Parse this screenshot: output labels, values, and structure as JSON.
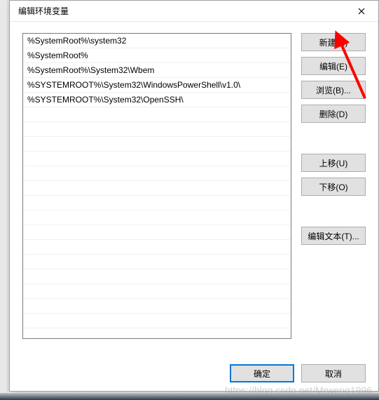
{
  "dialog": {
    "title": "编辑环境变量",
    "close_icon": "close"
  },
  "list": {
    "items": [
      "%SystemRoot%\\system32",
      "%SystemRoot%",
      "%SystemRoot%\\System32\\Wbem",
      "%SYSTEMROOT%\\System32\\WindowsPowerShell\\v1.0\\",
      "%SYSTEMROOT%\\System32\\OpenSSH\\"
    ]
  },
  "buttons": {
    "new": "新建(N)",
    "edit": "编辑(E)",
    "browse": "浏览(B)...",
    "delete": "删除(D)",
    "moveup": "上移(U)",
    "movedown": "下移(O)",
    "edittext": "编辑文本(T)...",
    "ok": "确定",
    "cancel": "取消"
  },
  "annotation": {
    "arrow_color": "#ff0000"
  },
  "watermark": "https://blog.csdn.net/Mrweng1996"
}
